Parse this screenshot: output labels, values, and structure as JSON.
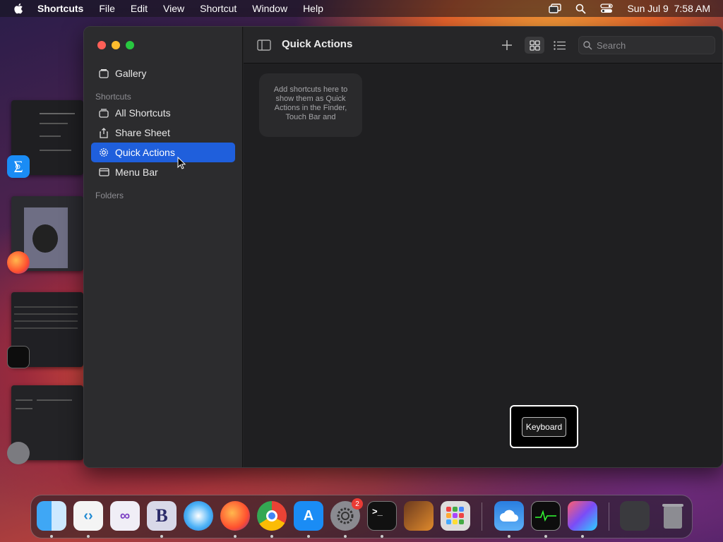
{
  "menubar": {
    "app_name": "Shortcuts",
    "menus": [
      "File",
      "Edit",
      "View",
      "Shortcut",
      "Window",
      "Help"
    ],
    "datetime": "Sun Jul 9  7:58 AM"
  },
  "window": {
    "sidebar": {
      "gallery_label": "Gallery",
      "shortcuts_header": "Shortcuts",
      "items": [
        {
          "label": "All Shortcuts",
          "icon": "stack-icon"
        },
        {
          "label": "Share Sheet",
          "icon": "share-icon"
        },
        {
          "label": "Quick Actions",
          "icon": "gear-icon",
          "selected": true
        },
        {
          "label": "Menu Bar",
          "icon": "menubar-icon"
        }
      ],
      "folders_header": "Folders"
    },
    "toolbar": {
      "title": "Quick Actions",
      "search_placeholder": "Search"
    },
    "empty_card_text": "Add shortcuts here to show them as Quick Actions in the Finder, Touch Bar and"
  },
  "keyboard_hint": "Keyboard",
  "dock": {
    "apps": [
      "Finder",
      "Visual Studio Code",
      "Visual Studio",
      "BBEdit",
      "Safari",
      "Firefox",
      "Chrome",
      "App Store",
      "System Settings",
      "Terminal",
      "GarageBand",
      "Launchpad",
      "Weather",
      "Activity Monitor",
      "Shortcuts",
      "Downloads",
      "Trash"
    ],
    "system_settings_badge": "2"
  },
  "colors": {
    "accent": "#1f5fdc",
    "window_bg": "#232325",
    "sidebar_bg": "#2c2c2e"
  }
}
